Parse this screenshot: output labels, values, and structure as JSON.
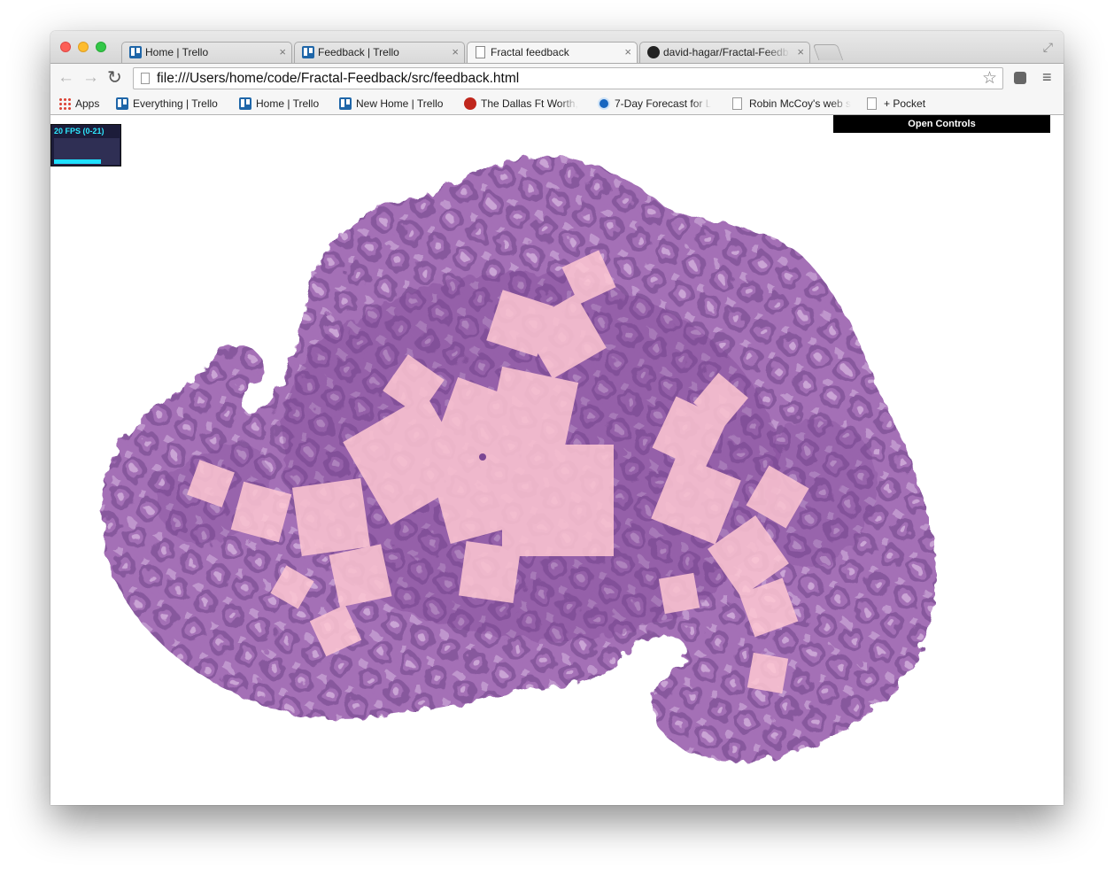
{
  "browser": {
    "tabs": [
      {
        "label": "Home | Trello",
        "icon": "trello-icon",
        "active": false
      },
      {
        "label": "Feedback | Trello",
        "icon": "trello-icon",
        "active": false
      },
      {
        "label": "Fractal feedback",
        "icon": "page-icon",
        "active": true
      },
      {
        "label": "david-hagar/Fractal-Feedb",
        "icon": "github-icon",
        "active": false
      }
    ],
    "close_glyph": "×",
    "url": "file:///Users/home/code/Fractal-Feedback/src/feedback.html",
    "back_glyph": "←",
    "forward_glyph": "→",
    "reload_glyph": "↻",
    "star_glyph": "☆",
    "menu_glyph": "≡",
    "fullscreen_glyph": "⤢",
    "bookmarks": [
      {
        "label": "Apps",
        "icon": "apps-icon"
      },
      {
        "label": "Everything | Trello",
        "icon": "trello-icon"
      },
      {
        "label": "Home | Trello",
        "icon": "trello-icon"
      },
      {
        "label": "New Home | Trello",
        "icon": "trello-icon"
      },
      {
        "label": "The Dallas Ft Worth,",
        "icon": "dallas-icon"
      },
      {
        "label": "7-Day Forecast for L",
        "icon": "noaa-icon"
      },
      {
        "label": "Robin McCoy's web s",
        "icon": "document-icon"
      },
      {
        "label": "+ Pocket",
        "icon": "document-icon"
      }
    ]
  },
  "page": {
    "fps_label": "20 FPS (0-21)",
    "fps_level": 0.72,
    "controls_label": "Open Controls",
    "colors": {
      "fractal_purple": "#9a5fae",
      "fractal_dark": "#7a4593",
      "square_pink": "#ffc8d2",
      "fps_cyan": "#2ee9ff"
    }
  }
}
